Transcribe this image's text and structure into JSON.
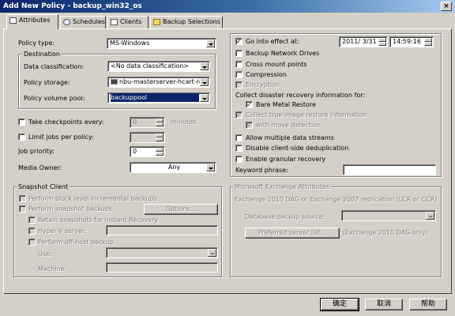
{
  "window": {
    "title": "Add New Policy - backup_win32_os"
  },
  "tabs": [
    {
      "label": "Attributes",
      "icon": "document-icon"
    },
    {
      "label": "Schedules",
      "icon": "clock-icon"
    },
    {
      "label": "Clients",
      "icon": "computer-icon"
    },
    {
      "label": "Backup Selections",
      "icon": "folder-icon"
    }
  ],
  "left": {
    "policy_type_label": "Policy type:",
    "policy_type_value": "MS-Windows",
    "destination_title": "Destination",
    "data_classification_label": "Data classification:",
    "data_classification_value": "<No data classification>",
    "policy_storage_label": "Policy storage:",
    "policy_storage_value": "nbu-masterserver-hcart-ro",
    "volume_pool_label": "Policy volume pool:",
    "volume_pool_value": "backuppool",
    "checkpoints_label": "Take checkpoints every:",
    "checkpoints_value": "0",
    "checkpoints_unit": "minutes",
    "limit_jobs_label": "Limit jobs per policy:",
    "limit_jobs_value": "",
    "job_priority_label": "Job priority:",
    "job_priority_value": "0",
    "media_owner_label": "Media Owner:",
    "media_owner_value": "Any"
  },
  "snapshot": {
    "title": "Snapshot Client",
    "block_level_label": "Perform block level incremental backups",
    "perform_snapshot_label": "Perform snapshot backups",
    "options_button": "Options...",
    "retain_label": "Retain snapshots for Instant Recovery",
    "hyperv_label": "Hyper-V server:",
    "hyperv_value": "",
    "offhost_label": "Perform off-host backup",
    "use_label": "Use:",
    "use_value": "",
    "machine_label": "Machine:",
    "machine_value": ""
  },
  "right": {
    "go_into_effect_label": "Go into effect at:",
    "go_into_effect_date": "2011/ 3/31",
    "go_into_effect_time": "14:59:16",
    "follow_nfs_label": "Backup Network Drives",
    "cross_mount_label": "Cross mount points",
    "compression_label": "Compression",
    "encryption_label": "Encryption",
    "collect_dr_label": "Collect disaster recovery information for:",
    "bmr_label": "Bare Metal Restore",
    "collect_true_image_label": "Collect true image restore information",
    "move_detection_label": "with move detection",
    "multiple_streams_label": "Allow multiple data streams",
    "disable_dedup_label": "Disable client-side deduplication",
    "granular_label": "Enable granular recovery",
    "keyword_label": "Keyword phrase:",
    "keyword_value": ""
  },
  "exchange": {
    "title": "Microsoft Exchange Attributes",
    "description": "Exchange 2010 DAG or Exchange 2007 replication (LCR or CCR)",
    "db_source_label": "Database backup source:",
    "db_source_value": "",
    "preferred_list_button": "Preferred server list...",
    "preferred_note": "(Exchange 2010 DAG only)"
  },
  "footer": {
    "ok": "确定",
    "cancel": "取消",
    "help": "帮助"
  },
  "colors": {
    "titlebar": "#0a246a",
    "face": "#d4d0c8",
    "selection": "#0a246a"
  }
}
